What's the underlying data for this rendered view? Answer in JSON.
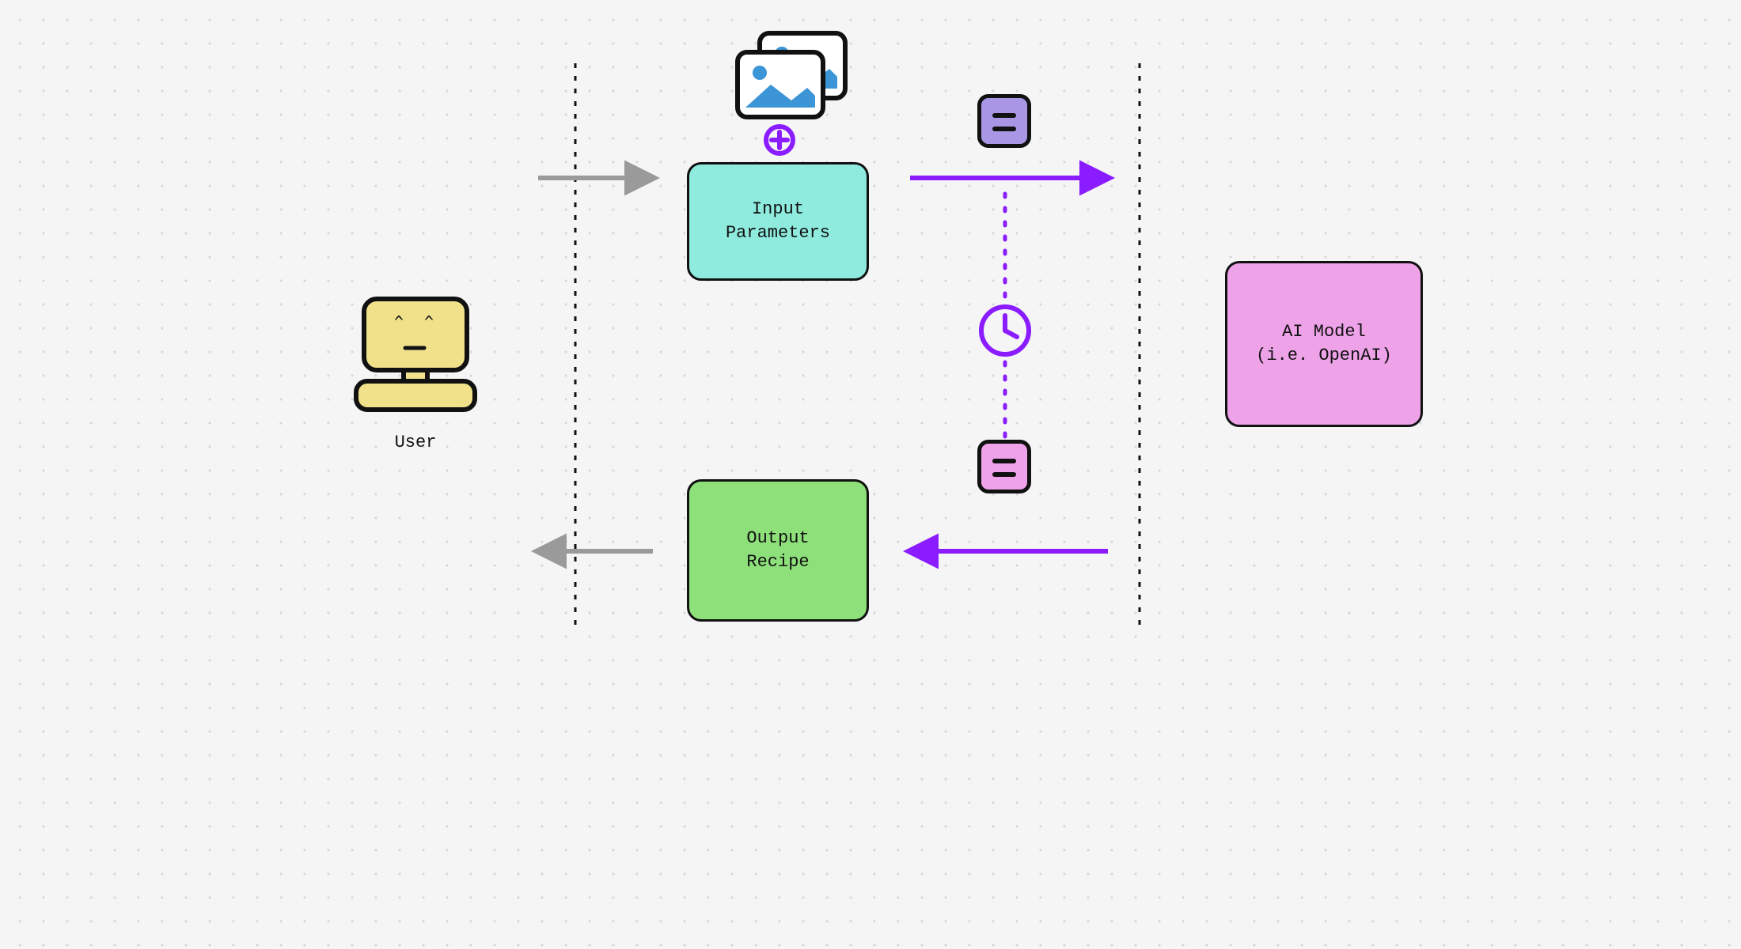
{
  "nodes": {
    "user_label": "User",
    "input_box": "Input\nParameters",
    "output_box": "Output\nRecipe",
    "model_box": "AI Model\n(i.e. OpenAI)"
  },
  "icons": {
    "user": "computer-user-icon",
    "images": "image-stack-icon",
    "plus": "plus-circle-icon",
    "clock": "clock-icon",
    "doc_top": "document-icon",
    "doc_bot": "document-icon"
  },
  "colors": {
    "input_fill": "#8eebde",
    "output_fill": "#8ee07a",
    "model_fill": "#eea2e8",
    "chip_top_fill": "#a997e6",
    "chip_bot_fill": "#eea2e8",
    "purple_stroke": "#8a1cff",
    "grey_arrow": "#9a9a9a",
    "computer_fill": "#f0e18a"
  }
}
